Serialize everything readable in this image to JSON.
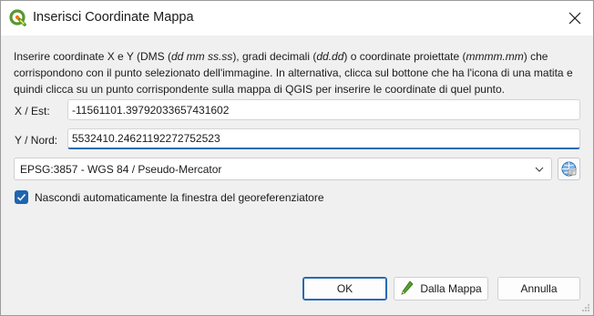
{
  "window": {
    "title": "Inserisci Coordinate Mappa"
  },
  "description": {
    "p1": "Inserire coordinate X e Y (DMS (",
    "dms_format": "dd mm ss.ss",
    "p2": "), gradi decimali (",
    "decimal_format": "dd.dd",
    "p3": ") o coordinate proiettate (",
    "projected_format": "mmmm.mm",
    "p4": ") che corrispondono con il punto selezionato dell'immagine. In alternativa, clicca sul bottone che ha l'icona di una matita e quindi clicca su un punto corrispondente sulla mappa di QGIS per inserire le coordinate di quel punto."
  },
  "fields": {
    "x_label": "X / Est:",
    "x_value": "-11561101.397920336574316​02",
    "y_label": "Y / Nord:",
    "y_value": "5532410.24621192272752523"
  },
  "crs": {
    "selected": "EPSG:3857 - WGS 84 / Pseudo-Mercator",
    "selector_icon": "globe-icon"
  },
  "options": {
    "auto_hide_label": "Nascondi automaticamente la finestra del georeferenziatore",
    "auto_hide_checked": true
  },
  "buttons": {
    "ok": "OK",
    "from_map": "Dalla Mappa",
    "cancel": "Annulla"
  },
  "colors": {
    "accent": "#1f64b0",
    "qgis_green": "#589632",
    "qgis_yellow": "#ee7913"
  }
}
